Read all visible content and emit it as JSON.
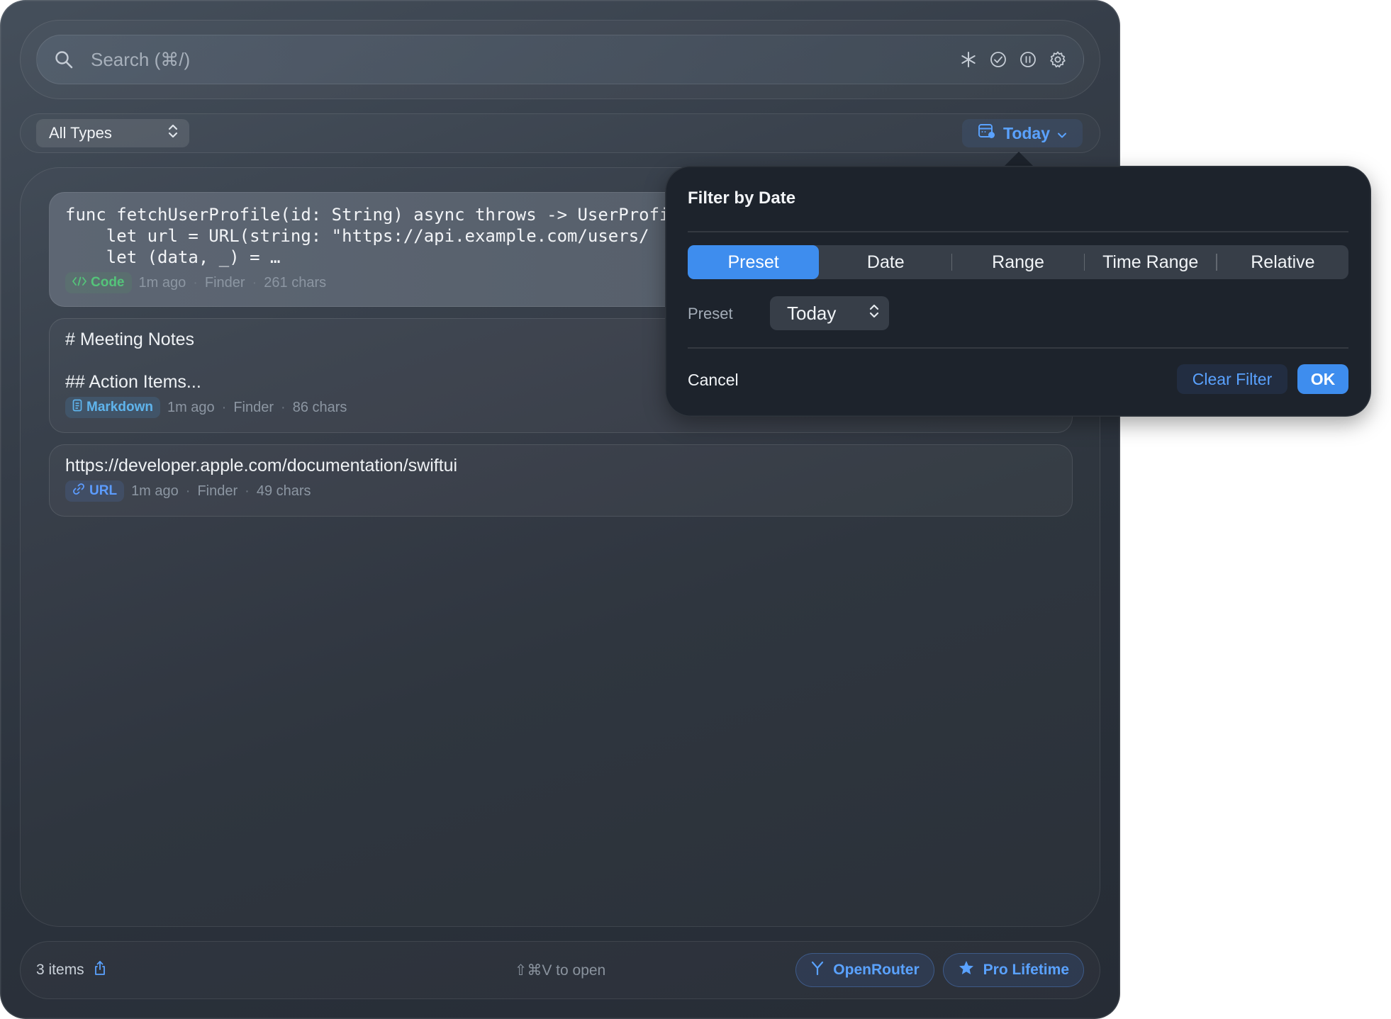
{
  "search": {
    "placeholder": "Search (⌘/)"
  },
  "filters": {
    "type_select": "All Types",
    "date_button": "Today"
  },
  "items": [
    {
      "content": "func fetchUserProfile(id: String) async throws -> UserProfile {\n    let url = URL(string: \"https://api.example.com/users/\n    let (data, _) = …",
      "type": "Code",
      "time": "1m ago",
      "source": "Finder",
      "size": "261 chars"
    },
    {
      "content": "# Meeting Notes\n\n## Action Items...",
      "type": "Markdown",
      "time": "1m ago",
      "source": "Finder",
      "size": "86 chars"
    },
    {
      "content": "https://developer.apple.com/documentation/swiftui",
      "type": "URL",
      "time": "1m ago",
      "source": "Finder",
      "size": "49 chars"
    }
  ],
  "footer": {
    "count": "3 items",
    "hint": "⇧⌘V to open",
    "openrouter": "OpenRouter",
    "pro": "Pro Lifetime"
  },
  "date_popover": {
    "title": "Filter by Date",
    "tabs": [
      "Preset",
      "Date",
      "Range",
      "Time Range",
      "Relative"
    ],
    "active_tab": "Preset",
    "preset_label": "Preset",
    "preset_value": "Today",
    "cancel": "Cancel",
    "clear": "Clear Filter",
    "ok": "OK"
  },
  "colors": {
    "accent": "#3e8dee",
    "link": "#5aa2ff",
    "code_badge": "#54c47a",
    "markdown_badge": "#5fb4ec"
  },
  "icons": {
    "search": "search-icon",
    "asterisk": "asterisk-icon",
    "check": "check-circle-icon",
    "pause": "pause-circle-icon",
    "settings": "gear-icon",
    "calendar": "calendar-icon",
    "share": "share-icon",
    "router": "fork-icon",
    "star": "star-icon"
  }
}
